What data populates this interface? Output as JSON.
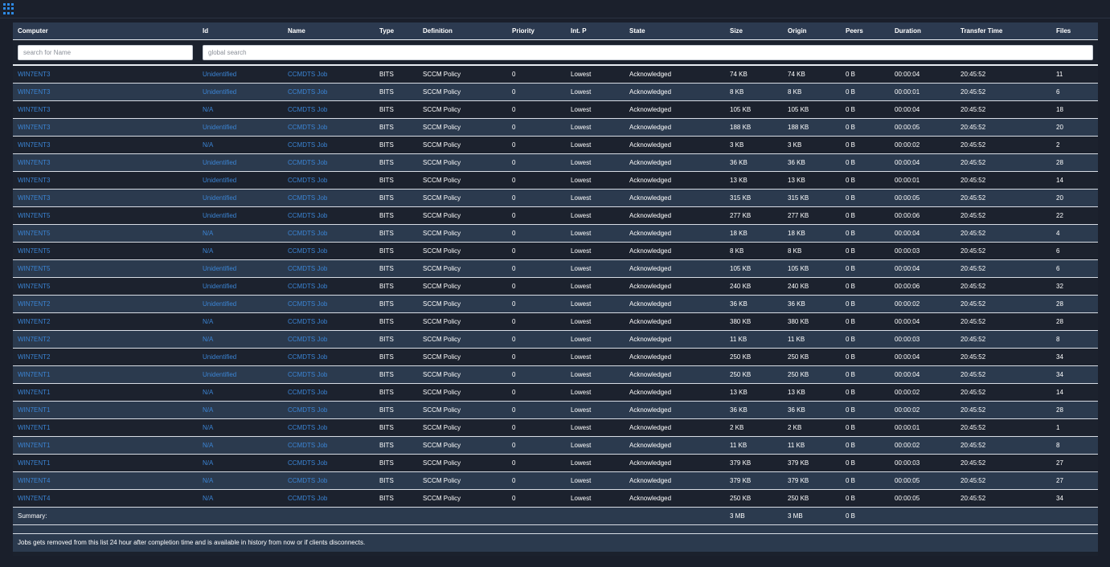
{
  "columns": [
    "Computer",
    "Id",
    "Name",
    "Type",
    "Definition",
    "Priority",
    "Int. P",
    "State",
    "Size",
    "Origin",
    "Peers",
    "Duration",
    "Transfer Time",
    "Files"
  ],
  "filters": {
    "name_placeholder": "search for Name",
    "global_placeholder": "global search"
  },
  "rows": [
    [
      "WIN7ENT3",
      "Unidentified",
      "CCMDTS Job",
      "BITS",
      "SCCM Policy",
      "0",
      "Lowest",
      "Acknowledged",
      "74 KB",
      "74 KB",
      "0 B",
      "00:00:04",
      "20:45:52",
      "11"
    ],
    [
      "WIN7ENT3",
      "Unidentified",
      "CCMDTS Job",
      "BITS",
      "SCCM Policy",
      "0",
      "Lowest",
      "Acknowledged",
      "8 KB",
      "8 KB",
      "0 B",
      "00:00:01",
      "20:45:52",
      "6"
    ],
    [
      "WIN7ENT3",
      "N/A",
      "CCMDTS Job",
      "BITS",
      "SCCM Policy",
      "0",
      "Lowest",
      "Acknowledged",
      "105 KB",
      "105 KB",
      "0 B",
      "00:00:04",
      "20:45:52",
      "18"
    ],
    [
      "WIN7ENT3",
      "Unidentified",
      "CCMDTS Job",
      "BITS",
      "SCCM Policy",
      "0",
      "Lowest",
      "Acknowledged",
      "188 KB",
      "188 KB",
      "0 B",
      "00:00:05",
      "20:45:52",
      "20"
    ],
    [
      "WIN7ENT3",
      "N/A",
      "CCMDTS Job",
      "BITS",
      "SCCM Policy",
      "0",
      "Lowest",
      "Acknowledged",
      "3 KB",
      "3 KB",
      "0 B",
      "00:00:02",
      "20:45:52",
      "2"
    ],
    [
      "WIN7ENT3",
      "Unidentified",
      "CCMDTS Job",
      "BITS",
      "SCCM Policy",
      "0",
      "Lowest",
      "Acknowledged",
      "36 KB",
      "36 KB",
      "0 B",
      "00:00:04",
      "20:45:52",
      "28"
    ],
    [
      "WIN7ENT3",
      "Unidentified",
      "CCMDTS Job",
      "BITS",
      "SCCM Policy",
      "0",
      "Lowest",
      "Acknowledged",
      "13 KB",
      "13 KB",
      "0 B",
      "00:00:01",
      "20:45:52",
      "14"
    ],
    [
      "WIN7ENT3",
      "Unidentified",
      "CCMDTS Job",
      "BITS",
      "SCCM Policy",
      "0",
      "Lowest",
      "Acknowledged",
      "315 KB",
      "315 KB",
      "0 B",
      "00:00:05",
      "20:45:52",
      "20"
    ],
    [
      "WIN7ENT5",
      "Unidentified",
      "CCMDTS Job",
      "BITS",
      "SCCM Policy",
      "0",
      "Lowest",
      "Acknowledged",
      "277 KB",
      "277 KB",
      "0 B",
      "00:00:06",
      "20:45:52",
      "22"
    ],
    [
      "WIN7ENT5",
      "N/A",
      "CCMDTS Job",
      "BITS",
      "SCCM Policy",
      "0",
      "Lowest",
      "Acknowledged",
      "18 KB",
      "18 KB",
      "0 B",
      "00:00:04",
      "20:45:52",
      "4"
    ],
    [
      "WIN7ENT5",
      "N/A",
      "CCMDTS Job",
      "BITS",
      "SCCM Policy",
      "0",
      "Lowest",
      "Acknowledged",
      "8 KB",
      "8 KB",
      "0 B",
      "00:00:03",
      "20:45:52",
      "6"
    ],
    [
      "WIN7ENT5",
      "Unidentified",
      "CCMDTS Job",
      "BITS",
      "SCCM Policy",
      "0",
      "Lowest",
      "Acknowledged",
      "105 KB",
      "105 KB",
      "0 B",
      "00:00:04",
      "20:45:52",
      "6"
    ],
    [
      "WIN7ENT5",
      "Unidentified",
      "CCMDTS Job",
      "BITS",
      "SCCM Policy",
      "0",
      "Lowest",
      "Acknowledged",
      "240 KB",
      "240 KB",
      "0 B",
      "00:00:06",
      "20:45:52",
      "32"
    ],
    [
      "WIN7ENT2",
      "Unidentified",
      "CCMDTS Job",
      "BITS",
      "SCCM Policy",
      "0",
      "Lowest",
      "Acknowledged",
      "36 KB",
      "36 KB",
      "0 B",
      "00:00:02",
      "20:45:52",
      "28"
    ],
    [
      "WIN7ENT2",
      "N/A",
      "CCMDTS Job",
      "BITS",
      "SCCM Policy",
      "0",
      "Lowest",
      "Acknowledged",
      "380 KB",
      "380 KB",
      "0 B",
      "00:00:04",
      "20:45:52",
      "28"
    ],
    [
      "WIN7ENT2",
      "N/A",
      "CCMDTS Job",
      "BITS",
      "SCCM Policy",
      "0",
      "Lowest",
      "Acknowledged",
      "11 KB",
      "11 KB",
      "0 B",
      "00:00:03",
      "20:45:52",
      "8"
    ],
    [
      "WIN7ENT2",
      "Unidentified",
      "CCMDTS Job",
      "BITS",
      "SCCM Policy",
      "0",
      "Lowest",
      "Acknowledged",
      "250 KB",
      "250 KB",
      "0 B",
      "00:00:04",
      "20:45:52",
      "34"
    ],
    [
      "WIN7ENT1",
      "Unidentified",
      "CCMDTS Job",
      "BITS",
      "SCCM Policy",
      "0",
      "Lowest",
      "Acknowledged",
      "250 KB",
      "250 KB",
      "0 B",
      "00:00:04",
      "20:45:52",
      "34"
    ],
    [
      "WIN7ENT1",
      "N/A",
      "CCMDTS Job",
      "BITS",
      "SCCM Policy",
      "0",
      "Lowest",
      "Acknowledged",
      "13 KB",
      "13 KB",
      "0 B",
      "00:00:02",
      "20:45:52",
      "14"
    ],
    [
      "WIN7ENT1",
      "N/A",
      "CCMDTS Job",
      "BITS",
      "SCCM Policy",
      "0",
      "Lowest",
      "Acknowledged",
      "36 KB",
      "36 KB",
      "0 B",
      "00:00:02",
      "20:45:52",
      "28"
    ],
    [
      "WIN7ENT1",
      "N/A",
      "CCMDTS Job",
      "BITS",
      "SCCM Policy",
      "0",
      "Lowest",
      "Acknowledged",
      "2 KB",
      "2 KB",
      "0 B",
      "00:00:01",
      "20:45:52",
      "1"
    ],
    [
      "WIN7ENT1",
      "N/A",
      "CCMDTS Job",
      "BITS",
      "SCCM Policy",
      "0",
      "Lowest",
      "Acknowledged",
      "11 KB",
      "11 KB",
      "0 B",
      "00:00:02",
      "20:45:52",
      "8"
    ],
    [
      "WIN7ENT1",
      "N/A",
      "CCMDTS Job",
      "BITS",
      "SCCM Policy",
      "0",
      "Lowest",
      "Acknowledged",
      "379 KB",
      "379 KB",
      "0 B",
      "00:00:03",
      "20:45:52",
      "27"
    ],
    [
      "WIN7ENT4",
      "N/A",
      "CCMDTS Job",
      "BITS",
      "SCCM Policy",
      "0",
      "Lowest",
      "Acknowledged",
      "379 KB",
      "379 KB",
      "0 B",
      "00:00:05",
      "20:45:52",
      "27"
    ],
    [
      "WIN7ENT4",
      "N/A",
      "CCMDTS Job",
      "BITS",
      "SCCM Policy",
      "0",
      "Lowest",
      "Acknowledged",
      "250 KB",
      "250 KB",
      "0 B",
      "00:00:05",
      "20:45:52",
      "34"
    ]
  ],
  "summary": {
    "label": "Summary:",
    "size": "3 MB",
    "origin": "3 MB",
    "peers": "0 B"
  },
  "footnote": "Jobs gets removed from this list 24 hour after completion time and is available in history from now or if clients disconnects.",
  "colors": {
    "link": "#3b84d4",
    "header_bg": "#2c3a50",
    "row_alt_bg": "#2b3a4e",
    "row_bg": "#1c222e",
    "app_icon": "#2e8ae6"
  },
  "icons": {
    "app_menu": "apps-grid-icon"
  }
}
